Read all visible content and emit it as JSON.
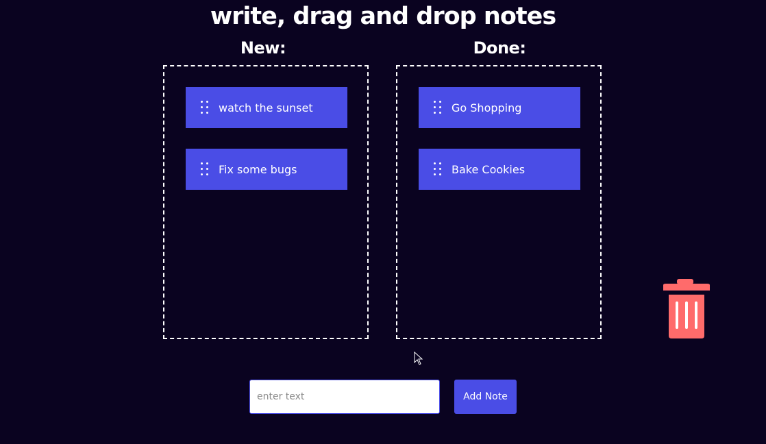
{
  "header": {
    "title": "write, drag and drop notes"
  },
  "columns": [
    {
      "heading": "New:",
      "notes": [
        {
          "text": "watch the sunset",
          "icon": "drag-handle-icon"
        },
        {
          "text": "Fix some bugs",
          "icon": "drag-handle-icon"
        }
      ]
    },
    {
      "heading": "Done:",
      "notes": [
        {
          "text": "Go Shopping",
          "icon": "drag-handle-icon"
        },
        {
          "text": "Bake Cookies",
          "icon": "drag-handle-icon"
        }
      ]
    }
  ],
  "trash": {
    "icon": "trash-icon",
    "color": "#ff6b6b"
  },
  "form": {
    "input_value": "",
    "input_placeholder": "enter text",
    "button_label": "Add Note"
  },
  "colors": {
    "background": "#0a0320",
    "accent": "#4a4de6",
    "text": "#ffffff",
    "trash": "#ff6b6b"
  }
}
